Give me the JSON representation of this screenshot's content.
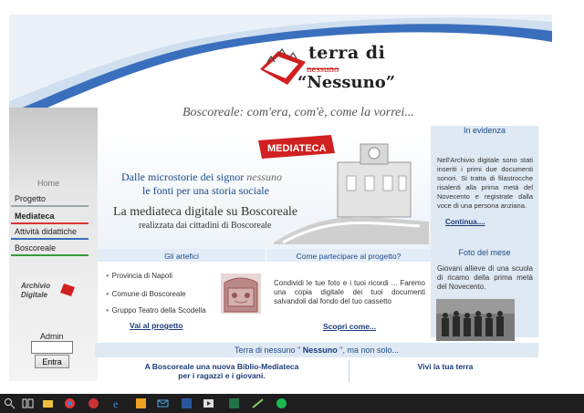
{
  "header": {
    "logo_title": "terra di",
    "logo_strike": "nessuno",
    "logo_name": "“Nessuno”",
    "tagline": "Boscoreale: com'era, com'è, come la vorrei..."
  },
  "hero": {
    "sign": "MEDIATECA",
    "line1_a": "Dalle microstorie dei signor ",
    "line1_b": "nessuno",
    "line2": "le fonti per una storia sociale",
    "line3": "La mediateca digitale su Boscoreale",
    "line4": "realizzata dai cittadini di Boscoreale"
  },
  "sidebar": {
    "home": "Home",
    "items": [
      {
        "label": "Progetto"
      },
      {
        "label": "Mediateca"
      },
      {
        "label": "Attività didattiche"
      },
      {
        "label": "Boscoreale"
      }
    ],
    "archivio": "Archivio",
    "digitale": "Digitale",
    "admin_label": "Admin",
    "admin_value": "",
    "entra": "Entra"
  },
  "evidenza": {
    "title": "In evidenza",
    "text": "Nell'Archivio digitale sono stati inseriti i primi due documenti sonori. Si tratta di filastrocche risalenti alla prima metà del Novecento e registrate dalla voce di una persona anziana.",
    "link": "Continua...."
  },
  "foto": {
    "title": "Foto del mese",
    "text": "Giovani allieve di una scuola di ricamo della prima metà del Novecento."
  },
  "artefici": {
    "title": "Gli artefici",
    "items": [
      "Provincia di Napoli",
      "Comune di Boscoreale",
      "Gruppo Teatro della Scodella"
    ],
    "link": "Vai al progetto"
  },
  "partecipare": {
    "title": "Come partecipare al progetto?",
    "text": "Condividi le tue foto e i tuoi ricordi ... Faremo una copia digitale dei tuoi documenti salvandoli dal fondo del tuo cassetto",
    "link": "Scopri come..."
  },
  "bottom": {
    "band_a": "Terra di nessuno \" ",
    "band_b": "Nessuno",
    "band_c": " \", ma non solo...",
    "left_1": "A Boscoreale una nuova Biblio-Mediateca",
    "left_2": "per i ragazzi e i giovani.",
    "right": "Vivi la tua terra"
  },
  "colors": {
    "accent_blue": "#1b4a8a",
    "panel_blue": "#dfe9f3",
    "logo_red": "#d02020"
  }
}
